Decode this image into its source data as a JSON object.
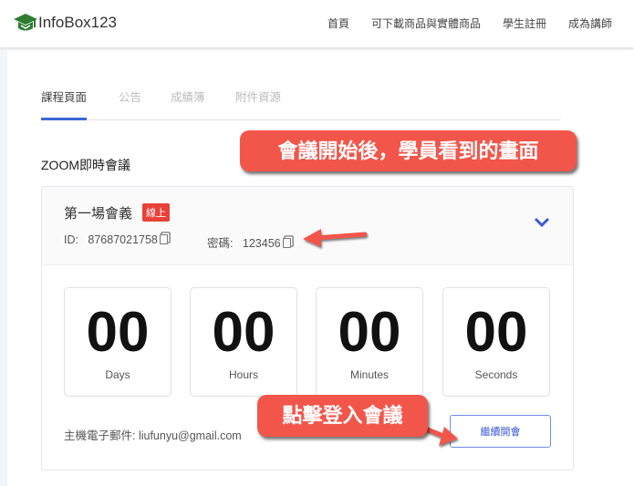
{
  "header": {
    "brand": "InfoBox123",
    "nav": [
      "首頁",
      "可下載商品與實體商品",
      "學生註冊",
      "成為講師"
    ]
  },
  "tabs": [
    {
      "label": "課程頁面",
      "active": true
    },
    {
      "label": "公告"
    },
    {
      "label": "成績簿"
    },
    {
      "label": "附件資源"
    }
  ],
  "section_title": "ZOOM即時會議",
  "meeting": {
    "name": "第一場會義",
    "status_badge": "線上",
    "id_label": "ID:",
    "id": "87687021758",
    "password_label": "密碼:",
    "password": "123456"
  },
  "countdown": [
    {
      "value": "00",
      "label": "Days"
    },
    {
      "value": "00",
      "label": "Hours"
    },
    {
      "value": "00",
      "label": "Minutes"
    },
    {
      "value": "00",
      "label": "Seconds"
    }
  ],
  "host_email": "主機電子郵件: liufunyu@gmail.com",
  "join_button": "繼續開會",
  "annotations": {
    "top": "會議開始後，學員看到的畫面",
    "bottom": "點擊登入會議"
  },
  "colors": {
    "accent": "#3b66d6",
    "badge": "#e8413a",
    "callout": "#f2564a",
    "logo": "#2e7d32"
  }
}
